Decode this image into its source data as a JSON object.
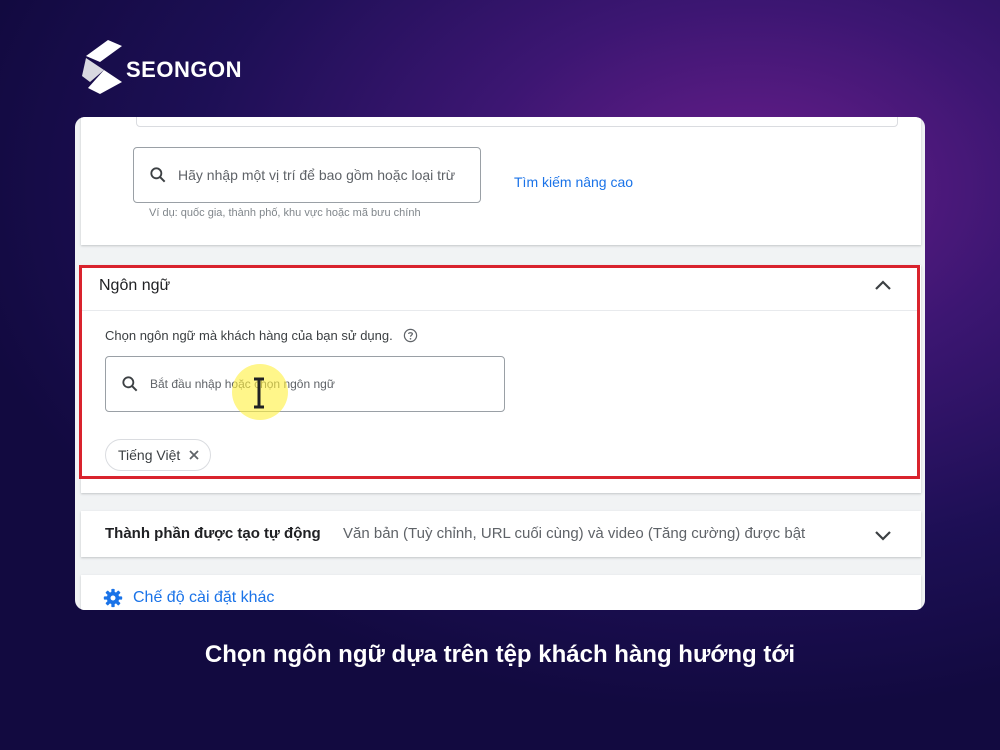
{
  "brand": {
    "name": "SEONGON",
    "logo_icon": "seongon-s-logo"
  },
  "location": {
    "search_placeholder": "Hãy nhập một vị trí để bao gồm hoặc loại trừ",
    "advanced_search_link": "Tìm kiếm nâng cao",
    "hint": "Ví dụ: quốc gia, thành phố, khu vực hoặc mã bưu chính"
  },
  "language": {
    "title": "Ngôn ngữ",
    "description": "Chọn ngôn ngữ mà khách hàng của bạn sử dụng.",
    "search_placeholder": "Bắt đầu nhập hoặc chọn ngôn ngữ",
    "selected_chip": "Tiếng Việt"
  },
  "auto_assets": {
    "title": "Thành phần được tạo tự động",
    "description": "Văn bản (Tuỳ chỉnh, URL cuối cùng) và video (Tăng cường) được bật"
  },
  "more_settings": {
    "label": "Chế độ cài đặt khác",
    "icon": "gear-icon"
  },
  "caption": "Chọn ngôn ngữ dựa trên tệp khách hàng hướng tới",
  "colors": {
    "link": "#1a73e8",
    "highlight_frame": "#d9232d"
  }
}
